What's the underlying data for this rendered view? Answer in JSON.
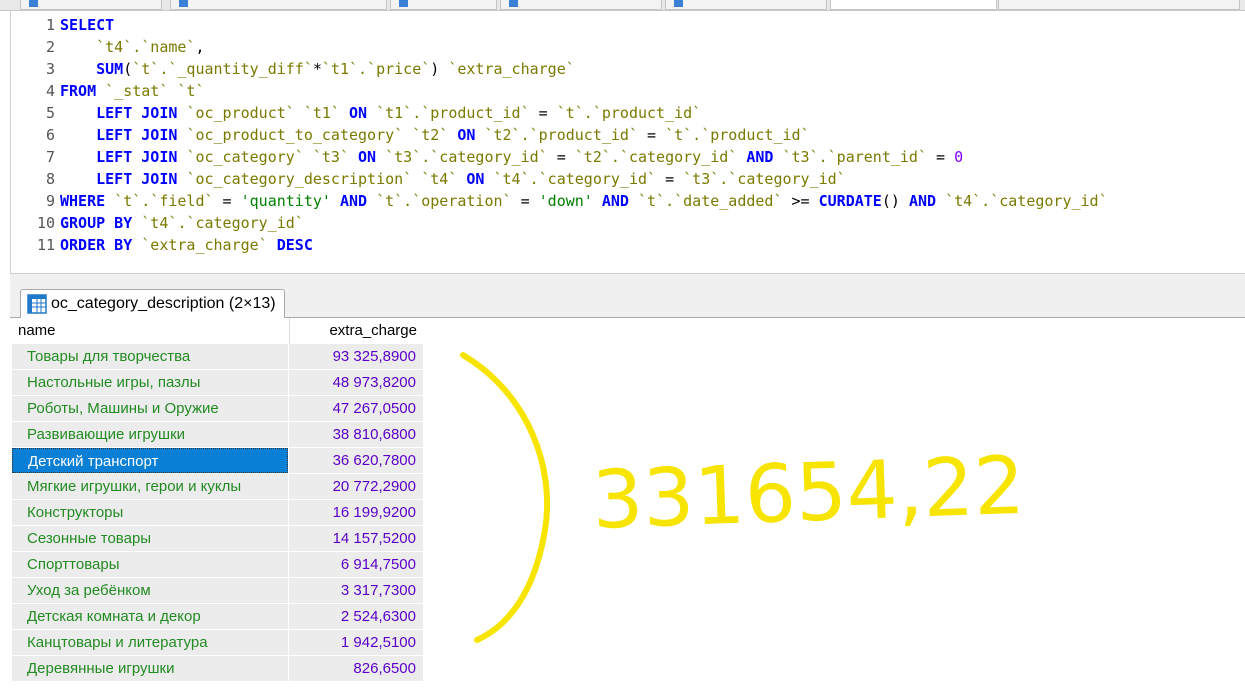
{
  "editor": {
    "line_numbers": [
      "1",
      "2",
      "3",
      "4",
      "5",
      "6",
      "7",
      "8",
      "9",
      "10",
      "11"
    ],
    "lines": [
      [
        {
          "t": "kw",
          "v": "SELECT"
        }
      ],
      [
        {
          "t": "op",
          "v": "    "
        },
        {
          "t": "id",
          "v": "`t4`.`name`"
        },
        {
          "t": "op",
          "v": ","
        }
      ],
      [
        {
          "t": "op",
          "v": "    "
        },
        {
          "t": "kw",
          "v": "SUM"
        },
        {
          "t": "op",
          "v": "("
        },
        {
          "t": "id",
          "v": "`t`.`_quantity_diff`"
        },
        {
          "t": "op",
          "v": "*"
        },
        {
          "t": "id",
          "v": "`t1`.`price`"
        },
        {
          "t": "op",
          "v": ") "
        },
        {
          "t": "id",
          "v": "`extra_charge`"
        }
      ],
      [
        {
          "t": "kw",
          "v": "FROM"
        },
        {
          "t": "op",
          "v": " "
        },
        {
          "t": "id",
          "v": "`_stat` `t`"
        }
      ],
      [
        {
          "t": "op",
          "v": "    "
        },
        {
          "t": "kw",
          "v": "LEFT JOIN"
        },
        {
          "t": "op",
          "v": " "
        },
        {
          "t": "id",
          "v": "`oc_product` `t1`"
        },
        {
          "t": "op",
          "v": " "
        },
        {
          "t": "kw",
          "v": "ON"
        },
        {
          "t": "op",
          "v": " "
        },
        {
          "t": "id",
          "v": "`t1`.`product_id`"
        },
        {
          "t": "op",
          "v": " = "
        },
        {
          "t": "id",
          "v": "`t`.`product_id`"
        }
      ],
      [
        {
          "t": "op",
          "v": "    "
        },
        {
          "t": "kw",
          "v": "LEFT JOIN"
        },
        {
          "t": "op",
          "v": " "
        },
        {
          "t": "id",
          "v": "`oc_product_to_category` `t2`"
        },
        {
          "t": "op",
          "v": " "
        },
        {
          "t": "kw",
          "v": "ON"
        },
        {
          "t": "op",
          "v": " "
        },
        {
          "t": "id",
          "v": "`t2`.`product_id`"
        },
        {
          "t": "op",
          "v": " = "
        },
        {
          "t": "id",
          "v": "`t`.`product_id`"
        }
      ],
      [
        {
          "t": "op",
          "v": "    "
        },
        {
          "t": "kw",
          "v": "LEFT JOIN"
        },
        {
          "t": "op",
          "v": " "
        },
        {
          "t": "id",
          "v": "`oc_category` `t3`"
        },
        {
          "t": "op",
          "v": " "
        },
        {
          "t": "kw",
          "v": "ON"
        },
        {
          "t": "op",
          "v": " "
        },
        {
          "t": "id",
          "v": "`t3`.`category_id`"
        },
        {
          "t": "op",
          "v": " = "
        },
        {
          "t": "id",
          "v": "`t2`.`category_id`"
        },
        {
          "t": "op",
          "v": " "
        },
        {
          "t": "kw",
          "v": "AND"
        },
        {
          "t": "op",
          "v": " "
        },
        {
          "t": "id",
          "v": "`t3`.`parent_id`"
        },
        {
          "t": "op",
          "v": " = "
        },
        {
          "t": "num",
          "v": "0"
        }
      ],
      [
        {
          "t": "op",
          "v": "    "
        },
        {
          "t": "kw",
          "v": "LEFT JOIN"
        },
        {
          "t": "op",
          "v": " "
        },
        {
          "t": "id",
          "v": "`oc_category_description` `t4`"
        },
        {
          "t": "op",
          "v": " "
        },
        {
          "t": "kw",
          "v": "ON"
        },
        {
          "t": "op",
          "v": " "
        },
        {
          "t": "id",
          "v": "`t4`.`category_id`"
        },
        {
          "t": "op",
          "v": " = "
        },
        {
          "t": "id",
          "v": "`t3`.`category_id`"
        }
      ],
      [
        {
          "t": "kw",
          "v": "WHERE"
        },
        {
          "t": "op",
          "v": " "
        },
        {
          "t": "id",
          "v": "`t`.`field`"
        },
        {
          "t": "op",
          "v": " = "
        },
        {
          "t": "str",
          "v": "'quantity'"
        },
        {
          "t": "op",
          "v": " "
        },
        {
          "t": "kw",
          "v": "AND"
        },
        {
          "t": "op",
          "v": " "
        },
        {
          "t": "id",
          "v": "`t`.`operation`"
        },
        {
          "t": "op",
          "v": " = "
        },
        {
          "t": "str",
          "v": "'down'"
        },
        {
          "t": "op",
          "v": " "
        },
        {
          "t": "kw",
          "v": "AND"
        },
        {
          "t": "op",
          "v": " "
        },
        {
          "t": "id",
          "v": "`t`.`date_added`"
        },
        {
          "t": "op",
          "v": " >= "
        },
        {
          "t": "kw",
          "v": "CURDATE"
        },
        {
          "t": "op",
          "v": "() "
        },
        {
          "t": "kw",
          "v": "AND"
        },
        {
          "t": "op",
          "v": " "
        },
        {
          "t": "id",
          "v": "`t4`.`category_id`"
        }
      ],
      [
        {
          "t": "kw",
          "v": "GROUP BY"
        },
        {
          "t": "op",
          "v": " "
        },
        {
          "t": "id",
          "v": "`t4`.`category_id`"
        }
      ],
      [
        {
          "t": "kw",
          "v": "ORDER BY"
        },
        {
          "t": "op",
          "v": " "
        },
        {
          "t": "id",
          "v": "`extra_charge`"
        },
        {
          "t": "op",
          "v": " "
        },
        {
          "t": "kw",
          "v": "DESC"
        }
      ]
    ]
  },
  "result_tab": {
    "label": "oc_category_description (2×13)",
    "icon": "table-grid-icon"
  },
  "grid": {
    "columns": [
      "name",
      "extra_charge"
    ],
    "selected_index": 4,
    "rows": [
      {
        "name": "Товары для творчества",
        "value": "93 325,8900"
      },
      {
        "name": "Настольные игры, пазлы",
        "value": "48 973,8200"
      },
      {
        "name": "Роботы, Машины и Оружие",
        "value": "47 267,0500"
      },
      {
        "name": "Развивающие игрушки",
        "value": "38 810,6800"
      },
      {
        "name": "Детский транспорт",
        "value": "36 620,7800"
      },
      {
        "name": "Мягкие игрушки, герои и куклы",
        "value": "20 772,2900"
      },
      {
        "name": "Конструкторы",
        "value": "16 199,9200"
      },
      {
        "name": "Сезонные товары",
        "value": "14 157,5200"
      },
      {
        "name": "Спорттовары",
        "value": "6 914,7500"
      },
      {
        "name": "Уход за ребёнком",
        "value": "3 317,7300"
      },
      {
        "name": "Детская комната и декор",
        "value": "2 524,6300"
      },
      {
        "name": "Канцтовары и литература",
        "value": "1 942,5100"
      },
      {
        "name": "Деревянные игрушки",
        "value": "826,6500"
      }
    ]
  },
  "annotation": {
    "text": "331654,22",
    "color": "#f7e400"
  },
  "colors": {
    "keyword": "#0000ff",
    "identifier": "#7a7a00",
    "string": "#008000",
    "number": "#8000ff",
    "name_text": "#228b22",
    "value_text": "#5a00c8",
    "selection": "#0a7fd6"
  }
}
